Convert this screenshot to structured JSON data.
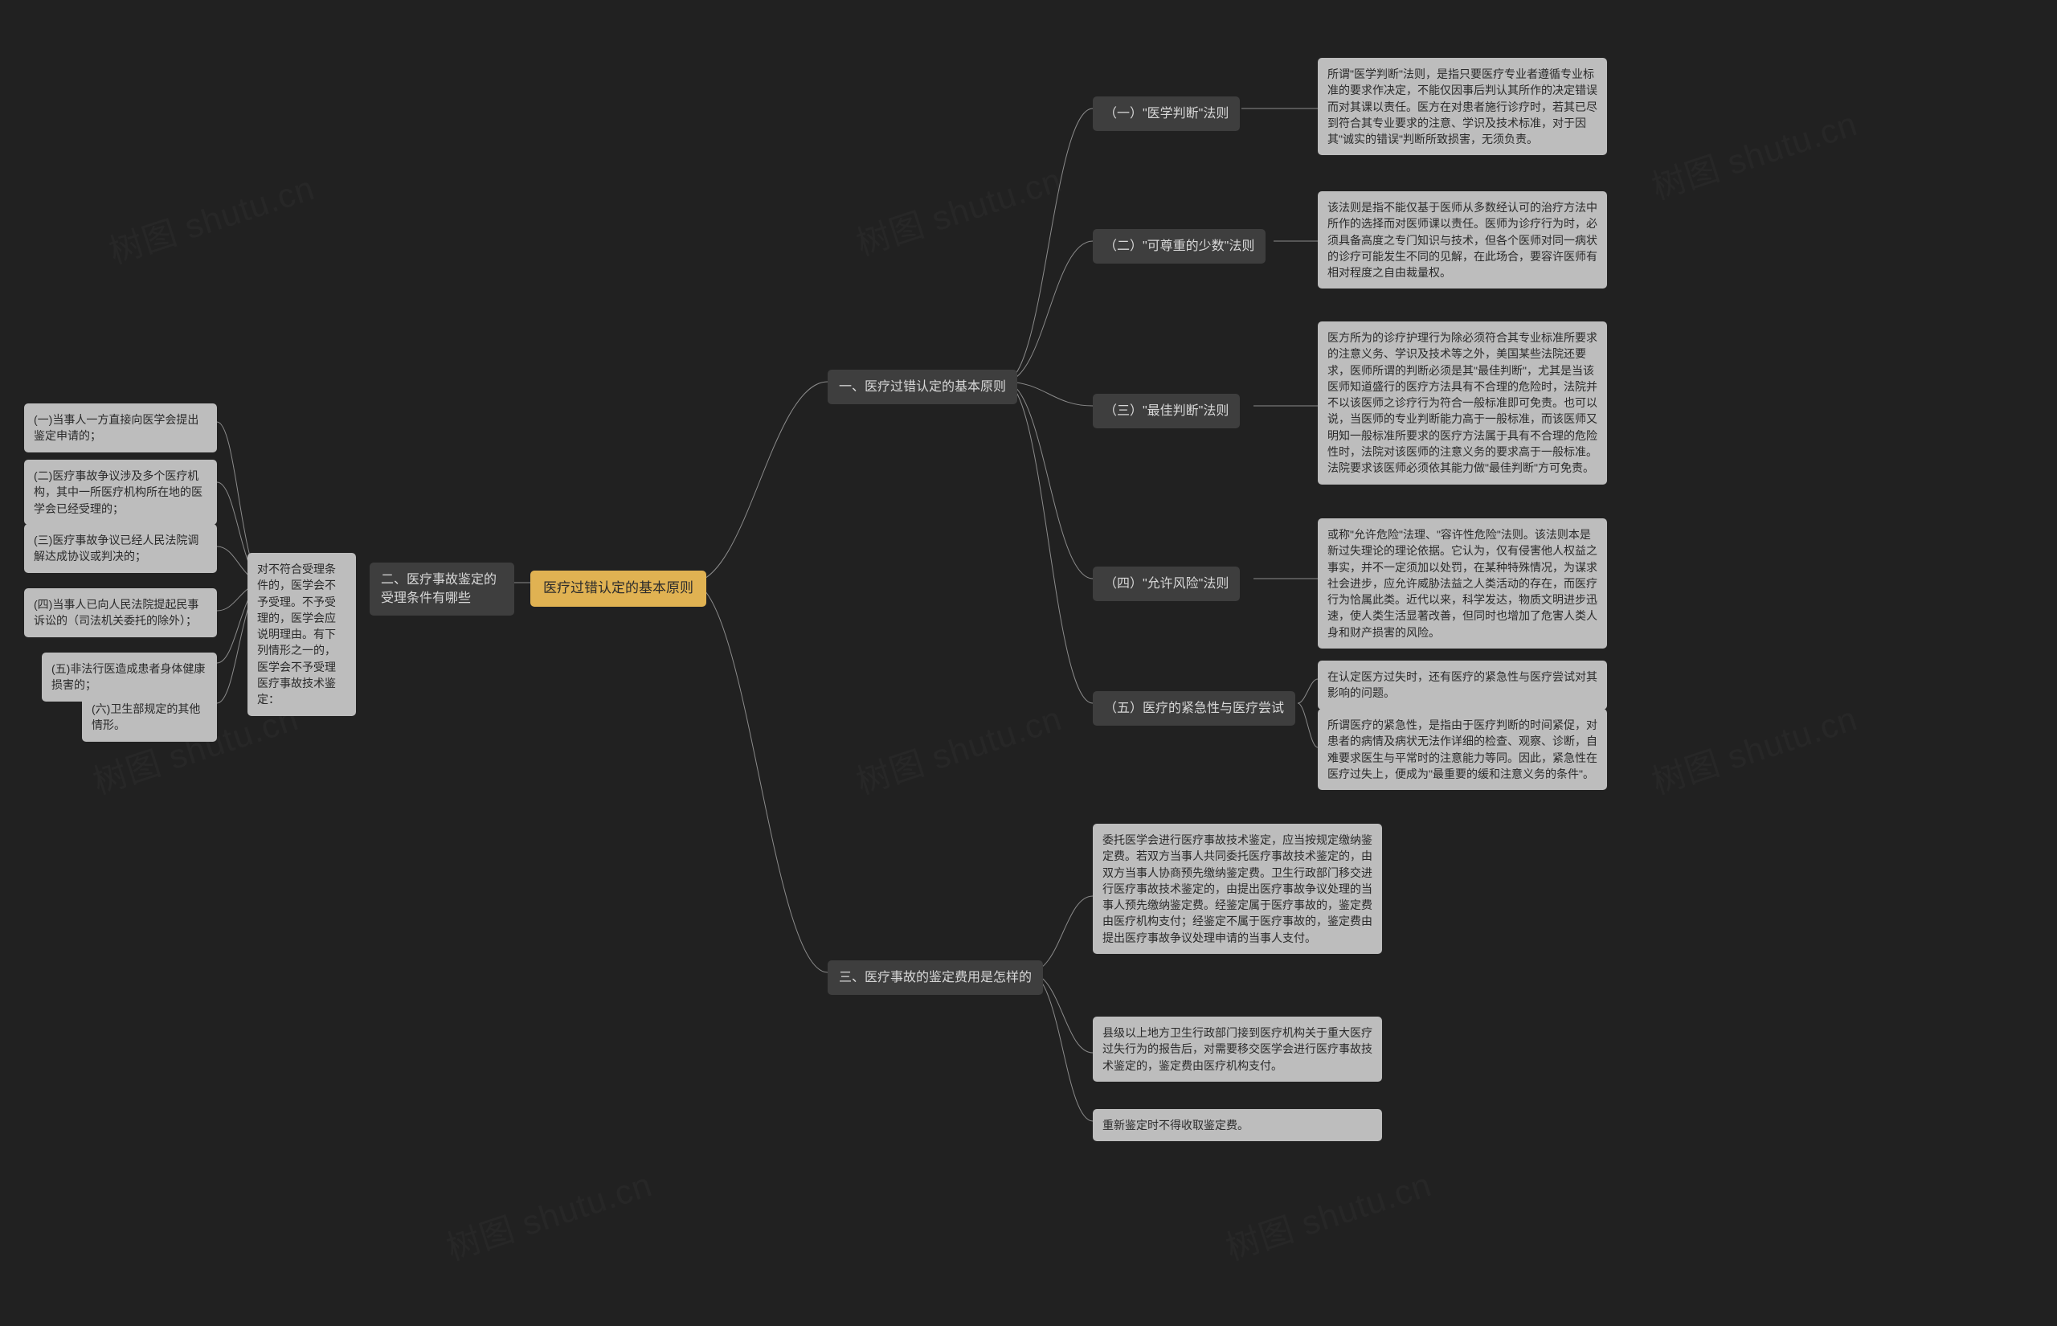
{
  "watermark": "树图 shutu.cn",
  "root": "医疗过错认定的基本原则",
  "b1": {
    "title": "一、医疗过错认定的基本原则",
    "c1": {
      "title": "（一）\"医学判断\"法则",
      "text": "所谓\"医学判断\"法则，是指只要医疗专业者遵循专业标准的要求作决定，不能仅因事后判认其所作的决定错误而对其课以责任。医方在对患者施行诊疗时，若其已尽到符合其专业要求的注意、学识及技术标准，对于因其\"诚实的错误\"判断所致损害，无须负责。"
    },
    "c2": {
      "title": "（二）\"可尊重的少数\"法则",
      "text": "该法则是指不能仅基于医师从多数经认可的治疗方法中所作的选择而对医师课以责任。医师为诊疗行为时，必须具备高度之专门知识与技术，但各个医师对同一病状的诊疗可能发生不同的见解，在此场合，要容许医师有相对程度之自由裁量权。"
    },
    "c3": {
      "title": "（三）\"最佳判断\"法则",
      "text": "医方所为的诊疗护理行为除必须符合其专业标准所要求的注意义务、学识及技术等之外，美国某些法院还要求，医师所谓的判断必须是其\"最佳判断\"，尤其是当该医师知道盛行的医疗方法具有不合理的危险时，法院并不以该医师之诊疗行为符合一般标准即可免责。也可以说，当医师的专业判断能力高于一般标准，而该医师又明知一般标准所要求的医疗方法属于具有不合理的危险性时，法院对该医师的注意义务的要求高于一般标准。法院要求该医师必须依其能力做\"最佳判断\"方可免责。"
    },
    "c4": {
      "title": "（四）\"允许风险\"法则",
      "text": "或称\"允许危险\"法理、\"容许性危险\"法则。该法则本是新过失理论的理论依据。它认为，仅有侵害他人权益之事实，并不一定须加以处罚，在某种特殊情况，为谋求社会进步，应允许威胁法益之人类活动的存在，而医疗行为恰属此类。近代以来，科学发达，物质文明进步迅速，使人类生活显著改善，但同时也增加了危害人类人身和财产损害的风险。"
    },
    "c5": {
      "title": "（五）医疗的紧急性与医疗尝试",
      "t1": "在认定医方过失时，还有医疗的紧急性与医疗尝试对其影响的问题。",
      "t2": "所谓医疗的紧急性，是指由于医疗判断的时间紧促，对患者的病情及病状无法作详细的检查、观察、诊断，自难要求医生与平常时的注意能力等同。因此，紧急性在医疗过失上，便成为\"最重要的缓和注意义务的条件\"。"
    }
  },
  "b2": {
    "title": "二、医疗事故鉴定的受理条件有哪些",
    "intro": "对不符合受理条件的，医学会不予受理。不予受理的，医学会应说明理由。有下列情形之一的，医学会不予受理医疗事故技术鉴定：",
    "l1": "(一)当事人一方直接向医学会提出鉴定申请的；",
    "l2": "(二)医疗事故争议涉及多个医疗机构，其中一所医疗机构所在地的医学会已经受理的；",
    "l3": "(三)医疗事故争议已经人民法院调解达成协议或判决的；",
    "l4": "(四)当事人已向人民法院提起民事诉讼的（司法机关委托的除外）；",
    "l5": "(五)非法行医造成患者身体健康损害的；",
    "l6": "(六)卫生部规定的其他情形。"
  },
  "b3": {
    "title": "三、医疗事故的鉴定费用是怎样的",
    "t1": "委托医学会进行医疗事故技术鉴定，应当按规定缴纳鉴定费。若双方当事人共同委托医疗事故技术鉴定的，由双方当事人协商预先缴纳鉴定费。卫生行政部门移交进行医疗事故技术鉴定的，由提出医疗事故争议处理的当事人预先缴纳鉴定费。经鉴定属于医疗事故的，鉴定费由医疗机构支付；经鉴定不属于医疗事故的，鉴定费由提出医疗事故争议处理申请的当事人支付。",
    "t2": "县级以上地方卫生行政部门接到医疗机构关于重大医疗过失行为的报告后，对需要移交医学会进行医疗事故技术鉴定的，鉴定费由医疗机构支付。",
    "t3": "重新鉴定时不得收取鉴定费。"
  }
}
